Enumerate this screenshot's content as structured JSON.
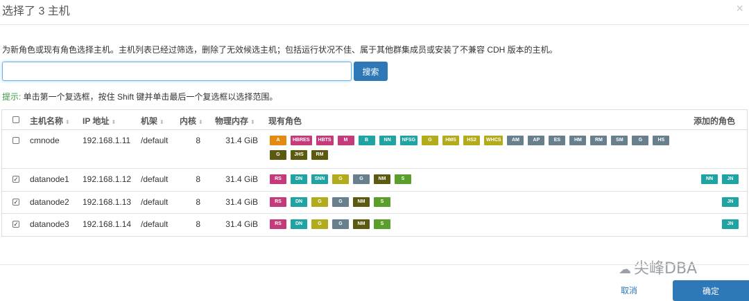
{
  "dialog": {
    "title": "选择了 3 主机",
    "close_symbol": "×"
  },
  "description": "为新角色或现有角色选择主机。主机列表已经过筛选，删除了无效候选主机；包括运行状况不佳、属于其他群集成员或安装了不兼容 CDH 版本的主机。",
  "search": {
    "value": "",
    "placeholder": "",
    "button_label": "搜索"
  },
  "hint": {
    "label": "提示:",
    "text": " 单击第一个复选框，按住 Shift 键并单击最后一个复选框以选择范围。"
  },
  "table": {
    "headers": {
      "hostname": "主机名称",
      "ip": "IP 地址",
      "rack": "机架",
      "cores": "内核",
      "memory": "物理内存",
      "roles": "现有角色",
      "added": "添加的角色"
    },
    "sort_symbol": "⬍",
    "rows": [
      {
        "checked": false,
        "hostname": "cmnode",
        "ip": "192.168.1.11",
        "rack": "/default",
        "cores": "8",
        "memory": "31.4 GiB",
        "roles": [
          {
            "label": "A",
            "color": "#e38a12"
          },
          {
            "label": "HBRES",
            "color": "#c53a7b"
          },
          {
            "label": "HBTS",
            "color": "#c53a7b"
          },
          {
            "label": "M",
            "color": "#c53a7b"
          },
          {
            "label": "B",
            "color": "#1fa3a3"
          },
          {
            "label": "NN",
            "color": "#1fa3a3"
          },
          {
            "label": "NFSG",
            "color": "#1fa3a3"
          },
          {
            "label": "G",
            "color": "#b3ab1e"
          },
          {
            "label": "HMS",
            "color": "#b3ab1e"
          },
          {
            "label": "HS2",
            "color": "#b3ab1e"
          },
          {
            "label": "WHCS",
            "color": "#b3ab1e"
          },
          {
            "label": "AM",
            "color": "#68808e"
          },
          {
            "label": "AP",
            "color": "#68808e"
          },
          {
            "label": "ES",
            "color": "#68808e"
          },
          {
            "label": "HM",
            "color": "#68808e"
          },
          {
            "label": "RM",
            "color": "#68808e"
          },
          {
            "label": "SM",
            "color": "#68808e"
          },
          {
            "label": "G",
            "color": "#68808e"
          },
          {
            "label": "HS",
            "color": "#68808e"
          },
          {
            "label": "G",
            "color": "#5c5a10"
          },
          {
            "label": "JHS",
            "color": "#5c5a10"
          },
          {
            "label": "RM",
            "color": "#5c5a10"
          }
        ],
        "added": []
      },
      {
        "checked": true,
        "hostname": "datanode1",
        "ip": "192.168.1.12",
        "rack": "/default",
        "cores": "8",
        "memory": "31.4 GiB",
        "roles": [
          {
            "label": "RS",
            "color": "#c53a7b"
          },
          {
            "label": "DN",
            "color": "#1fa3a3"
          },
          {
            "label": "SNN",
            "color": "#1fa3a3"
          },
          {
            "label": "G",
            "color": "#b3ab1e"
          },
          {
            "label": "G",
            "color": "#68808e"
          },
          {
            "label": "NM",
            "color": "#5c5a10"
          },
          {
            "label": "S",
            "color": "#5a9e2c"
          }
        ],
        "added": [
          {
            "label": "NN",
            "color": "#1fa3a3"
          },
          {
            "label": "JN",
            "color": "#1fa3a3"
          }
        ]
      },
      {
        "checked": true,
        "hostname": "datanode2",
        "ip": "192.168.1.13",
        "rack": "/default",
        "cores": "8",
        "memory": "31.4 GiB",
        "roles": [
          {
            "label": "RS",
            "color": "#c53a7b"
          },
          {
            "label": "DN",
            "color": "#1fa3a3"
          },
          {
            "label": "G",
            "color": "#b3ab1e"
          },
          {
            "label": "G",
            "color": "#68808e"
          },
          {
            "label": "NM",
            "color": "#5c5a10"
          },
          {
            "label": "S",
            "color": "#5a9e2c"
          }
        ],
        "added": [
          {
            "label": "JN",
            "color": "#1fa3a3"
          }
        ]
      },
      {
        "checked": true,
        "hostname": "datanode3",
        "ip": "192.168.1.14",
        "rack": "/default",
        "cores": "8",
        "memory": "31.4 GiB",
        "roles": [
          {
            "label": "RS",
            "color": "#c53a7b"
          },
          {
            "label": "DN",
            "color": "#1fa3a3"
          },
          {
            "label": "G",
            "color": "#b3ab1e"
          },
          {
            "label": "G",
            "color": "#68808e"
          },
          {
            "label": "NM",
            "color": "#5c5a10"
          },
          {
            "label": "S",
            "color": "#5a9e2c"
          }
        ],
        "added": [
          {
            "label": "JN",
            "color": "#1fa3a3"
          }
        ]
      }
    ]
  },
  "watermark": {
    "icon": "wechat-icon",
    "text": "尖峰DBA"
  },
  "footer": {
    "cancel_label": "取消",
    "confirm_label": "确定"
  }
}
